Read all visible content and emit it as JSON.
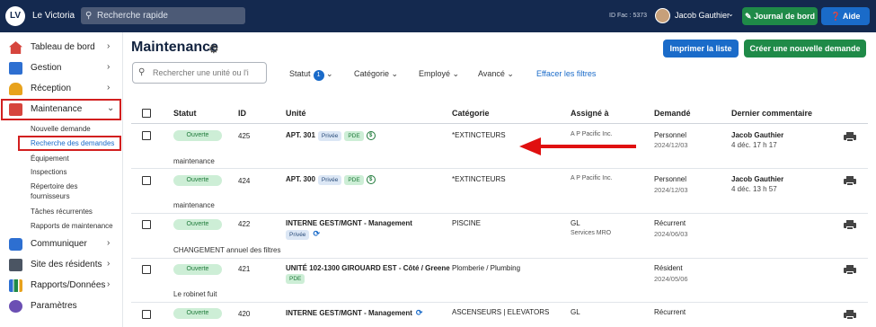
{
  "topbar": {
    "logo_text": "LV",
    "app_name": "Le Victoria",
    "search_placeholder": "Recherche rapide",
    "id_fac": "ID Fac : 5373",
    "user_name": "Jacob Gauthier",
    "journal_label": "Journal de bord",
    "aide_label": "Aide"
  },
  "sidebar": {
    "items": [
      {
        "label": "Tableau de bord",
        "icon": "house-icon"
      },
      {
        "label": "Gestion",
        "icon": "building-icon"
      },
      {
        "label": "Réception",
        "icon": "bell-icon"
      },
      {
        "label": "Maintenance",
        "icon": "toolbox-icon"
      },
      {
        "label": "Communiquer",
        "icon": "chat-icon"
      },
      {
        "label": "Site des résidents",
        "icon": "monitor-icon"
      },
      {
        "label": "Rapports/Données",
        "icon": "chart-icon"
      },
      {
        "label": "Paramètres",
        "icon": "gear-icon"
      }
    ],
    "maintenance_sub": [
      "Nouvelle demande",
      "Recherche des demandes",
      "Équipement",
      "Inspections",
      "Répertoire des",
      "fournisseurs",
      "Tâches récurrentes",
      "Rapports de maintenance"
    ]
  },
  "page": {
    "title": "Maintenance",
    "print_label": "Imprimer la liste",
    "create_label": "Créer une nouvelle demande",
    "search_placeholder": "Rechercher une unité ou l'i",
    "filters": {
      "statut": "Statut",
      "statut_count": "1",
      "categorie": "Catégorie",
      "employe": "Employé",
      "avance": "Avancé",
      "clear": "Effacer les filtres"
    }
  },
  "table": {
    "headers": [
      "Statut",
      "ID",
      "Unité",
      "Catégorie",
      "Assigné à",
      "Demandé",
      "Dernier commentaire"
    ],
    "tag_privee": "Privée",
    "tag_pde": "PDE",
    "dollar_symbol": "$",
    "rows": [
      {
        "status": "Ouverte",
        "id": "425",
        "unit": "APT. 301",
        "category": "*EXTINCTEURS",
        "assigned": "A P Pacific Inc.",
        "assigned_sub": "",
        "requested": "Personnel",
        "requested_date": "2024/12/03",
        "comment_name": "Jacob Gauthier",
        "comment_date": "4 déc. 17 h 17",
        "description": "maintenance"
      },
      {
        "status": "Ouverte",
        "id": "424",
        "unit": "APT. 300",
        "category": "*EXTINCTEURS",
        "assigned": "A P Pacific Inc.",
        "assigned_sub": "",
        "requested": "Personnel",
        "requested_date": "2024/12/03",
        "comment_name": "Jacob Gauthier",
        "comment_date": "4 déc. 13 h 57",
        "description": "maintenance"
      },
      {
        "status": "Ouverte",
        "id": "422",
        "unit": "INTERNE GEST/MGNT - Management",
        "category": "PISCINE",
        "assigned": "GL",
        "assigned_sub": "Services MRO",
        "requested": "Récurrent",
        "requested_date": "2024/06/03",
        "comment_name": "",
        "comment_date": "",
        "description": "CHANGEMENT annuel des filtres"
      },
      {
        "status": "Ouverte",
        "id": "421",
        "unit": "UNITÉ 102-1300 GIROUARD EST - Côté / Greene",
        "category": "Plomberie / Plumbing",
        "assigned": "",
        "assigned_sub": "",
        "requested": "Résident",
        "requested_date": "2024/05/06",
        "comment_name": "",
        "comment_date": "",
        "description": "Le robinet fuit"
      },
      {
        "status": "Ouverte",
        "id": "420",
        "unit": "INTERNE GEST/MGNT - Management",
        "category": "ASCENSEURS | ELEVATORS",
        "assigned": "GL",
        "assigned_sub": "",
        "requested": "Récurrent",
        "requested_date": "",
        "comment_name": "",
        "comment_date": "",
        "description": ""
      }
    ]
  },
  "colors": {
    "topbar": "#14294f",
    "primary_blue": "#1a6bc9",
    "green": "#1f8a48",
    "highlight_red": "#d21f1f"
  }
}
